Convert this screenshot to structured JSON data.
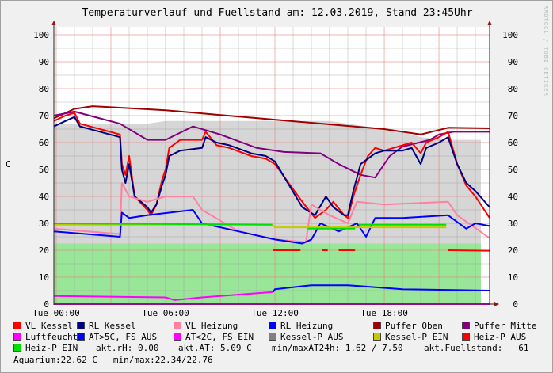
{
  "chart_data": {
    "type": "line",
    "title": "Temperaturverlauf und Fuellstand am: 12.03.2019, Stand 23:45Uhr",
    "ylabel": "C",
    "watermark": "RRDTOOL / TOBI OETIKER",
    "ylim": [
      0,
      100
    ],
    "xlim": [
      -0.13,
      23.78
    ],
    "yticks": [
      0,
      10,
      20,
      30,
      40,
      50,
      60,
      70,
      80,
      90,
      100
    ],
    "xticks": [
      {
        "h": 0,
        "label": "Tue 00:00"
      },
      {
        "h": 6,
        "label": "Tue 06:00"
      },
      {
        "h": 12,
        "label": "Tue 12:00"
      },
      {
        "h": 18,
        "label": "Tue 18:00"
      }
    ],
    "areas": [
      {
        "name": "Kessel-P AUS",
        "color": "#d6d6d6",
        "points": [
          [
            -0.13,
            67
          ],
          [
            2,
            67
          ],
          [
            5,
            67
          ],
          [
            6,
            68
          ],
          [
            10,
            68
          ],
          [
            15,
            68
          ],
          [
            16,
            67
          ],
          [
            18,
            65
          ],
          [
            19,
            64
          ],
          [
            20,
            62
          ],
          [
            21.5,
            61
          ],
          [
            23.3,
            61
          ],
          [
            23.3,
            0
          ]
        ]
      },
      {
        "name": "Fuellstand",
        "color": "#99e699",
        "points": [
          [
            -0.13,
            22.5
          ],
          [
            10,
            22.5
          ],
          [
            15,
            22.5
          ],
          [
            20,
            22.5
          ],
          [
            23.3,
            22.5
          ],
          [
            23.3,
            0
          ]
        ]
      }
    ],
    "series": [
      {
        "name": "Puffer Oben",
        "color": "#a00000",
        "points": [
          [
            -0.13,
            69
          ],
          [
            1,
            72.5
          ],
          [
            2,
            73.5
          ],
          [
            6,
            72
          ],
          [
            12,
            68.5
          ],
          [
            18,
            65
          ],
          [
            20,
            63
          ],
          [
            21.5,
            65.5
          ],
          [
            23.78,
            65.3
          ]
        ]
      },
      {
        "name": "Puffer Mitte",
        "color": "#800080",
        "points": [
          [
            -0.13,
            70
          ],
          [
            1,
            71.5
          ],
          [
            3.5,
            67
          ],
          [
            5,
            61
          ],
          [
            6,
            61
          ],
          [
            7.5,
            66
          ],
          [
            9,
            63
          ],
          [
            11,
            58
          ],
          [
            12.5,
            56.5
          ],
          [
            14.5,
            56
          ],
          [
            15.5,
            52
          ],
          [
            16.7,
            48
          ],
          [
            17.5,
            47
          ],
          [
            18.3,
            55
          ],
          [
            19,
            58.5
          ],
          [
            20.5,
            61
          ],
          [
            21,
            63
          ],
          [
            21.8,
            64
          ],
          [
            23.78,
            64
          ]
        ]
      },
      {
        "name": "VL Kessel",
        "color": "#ff0000",
        "points": [
          [
            -0.13,
            68
          ],
          [
            0.5,
            70
          ],
          [
            1,
            71
          ],
          [
            1.3,
            67
          ],
          [
            3.5,
            63
          ],
          [
            3.6,
            52
          ],
          [
            3.8,
            48
          ],
          [
            4,
            55
          ],
          [
            4.3,
            40
          ],
          [
            5,
            35
          ],
          [
            5.2,
            33
          ],
          [
            5.5,
            37
          ],
          [
            5.8,
            46
          ],
          [
            6,
            50
          ],
          [
            6.2,
            58
          ],
          [
            6.8,
            61
          ],
          [
            8,
            61
          ],
          [
            8.2,
            64
          ],
          [
            8.8,
            59
          ],
          [
            9.5,
            58
          ],
          [
            10.7,
            55
          ],
          [
            11.5,
            54
          ],
          [
            12,
            52
          ],
          [
            13.5,
            38
          ],
          [
            14.2,
            32
          ],
          [
            14.8,
            35
          ],
          [
            15.2,
            38
          ],
          [
            15.8,
            33
          ],
          [
            16,
            32
          ],
          [
            16.3,
            40
          ],
          [
            16.7,
            48
          ],
          [
            17.1,
            55
          ],
          [
            17.5,
            58
          ],
          [
            18,
            57
          ],
          [
            19,
            59
          ],
          [
            19.5,
            60
          ],
          [
            20,
            56
          ],
          [
            20.3,
            60
          ],
          [
            21,
            62
          ],
          [
            21.5,
            64
          ],
          [
            22,
            52
          ],
          [
            22.5,
            44
          ],
          [
            23,
            40
          ],
          [
            23.78,
            32
          ]
        ]
      },
      {
        "name": "RL Kessel",
        "color": "#000080",
        "points": [
          [
            -0.13,
            66
          ],
          [
            0.5,
            68
          ],
          [
            1,
            69.5
          ],
          [
            1.3,
            66
          ],
          [
            3.5,
            62
          ],
          [
            3.6,
            50
          ],
          [
            3.8,
            45
          ],
          [
            4,
            52
          ],
          [
            4.3,
            40
          ],
          [
            5,
            36
          ],
          [
            5.2,
            34
          ],
          [
            5.5,
            37
          ],
          [
            5.8,
            44
          ],
          [
            6,
            48
          ],
          [
            6.2,
            55
          ],
          [
            6.8,
            57
          ],
          [
            8,
            58
          ],
          [
            8.2,
            62
          ],
          [
            8.8,
            60
          ],
          [
            9.5,
            59
          ],
          [
            10.7,
            56
          ],
          [
            11.5,
            55
          ],
          [
            12,
            53
          ],
          [
            13.5,
            36
          ],
          [
            14.2,
            33
          ],
          [
            14.8,
            40
          ],
          [
            15.2,
            36
          ],
          [
            15.8,
            33
          ],
          [
            16,
            33
          ],
          [
            16.3,
            42
          ],
          [
            16.7,
            52
          ],
          [
            17.1,
            54
          ],
          [
            17.5,
            56
          ],
          [
            18,
            57
          ],
          [
            19,
            57
          ],
          [
            19.5,
            58
          ],
          [
            20,
            52
          ],
          [
            20.3,
            58
          ],
          [
            21,
            60
          ],
          [
            21.5,
            62
          ],
          [
            22,
            52
          ],
          [
            22.5,
            45
          ],
          [
            23,
            42
          ],
          [
            23.78,
            36
          ]
        ]
      },
      {
        "name": "VL Heizung",
        "color": "#ff80a0",
        "points": [
          [
            -0.13,
            28
          ],
          [
            3.5,
            26
          ],
          [
            3.6,
            45
          ],
          [
            4,
            40
          ],
          [
            5,
            38
          ],
          [
            6,
            40
          ],
          [
            7.5,
            40
          ],
          [
            8,
            35
          ],
          [
            10,
            27
          ],
          [
            12,
            24
          ],
          [
            13.7,
            23
          ],
          [
            14,
            37
          ],
          [
            15,
            33
          ],
          [
            16,
            30
          ],
          [
            16.5,
            38
          ],
          [
            18,
            37
          ],
          [
            21.5,
            38
          ],
          [
            22,
            33
          ],
          [
            23.78,
            24.5
          ]
        ]
      },
      {
        "name": "RL Heizung",
        "color": "#0000ff",
        "points": [
          [
            -0.13,
            27
          ],
          [
            3.5,
            25
          ],
          [
            3.6,
            34
          ],
          [
            4,
            32
          ],
          [
            5,
            33
          ],
          [
            7.5,
            35
          ],
          [
            8,
            30
          ],
          [
            10,
            27
          ],
          [
            12,
            24
          ],
          [
            13.5,
            22.5
          ],
          [
            14,
            24
          ],
          [
            14.5,
            30
          ],
          [
            15.5,
            27
          ],
          [
            16.5,
            30
          ],
          [
            17,
            25
          ],
          [
            17.5,
            32
          ],
          [
            19,
            32
          ],
          [
            21.5,
            33
          ],
          [
            22.5,
            28
          ],
          [
            23,
            30
          ],
          [
            23.78,
            29
          ]
        ]
      },
      {
        "name": "Kessel-P EIN",
        "color": "#c8c800",
        "points": [
          [
            -0.13,
            29.5
          ],
          [
            11.85,
            29.5
          ],
          [
            12,
            28.5
          ],
          [
            21.4,
            28.5
          ]
        ]
      },
      {
        "name": "Heiz-P EIN",
        "color": "#00e000",
        "points": [
          [
            -0.13,
            30
          ],
          [
            11.85,
            29.5
          ],
          null,
          [
            13.8,
            28
          ],
          [
            16.4,
            28
          ],
          null,
          [
            16.6,
            29.5
          ],
          [
            21.4,
            29.5
          ]
        ]
      },
      {
        "name": "Heiz-P AUS",
        "color": "#ff0000",
        "points": [
          [
            11.9,
            20
          ],
          [
            13.4,
            20
          ],
          null,
          [
            14.6,
            20
          ],
          [
            14.9,
            20
          ],
          null,
          [
            15.5,
            20
          ],
          [
            16.4,
            20
          ],
          null,
          [
            21.5,
            20
          ],
          [
            23.78,
            19.8
          ]
        ]
      },
      {
        "name": "AT<2C, FS EIN",
        "color": "#ff00ff",
        "points": [
          [
            -0.13,
            3
          ],
          [
            6,
            2.5
          ],
          [
            6.5,
            1.5
          ],
          [
            8,
            2.5
          ],
          [
            11.9,
            4.5
          ]
        ]
      },
      {
        "name": "AT>5C, FS AUS",
        "color": "#0000ff",
        "points": [
          [
            11.9,
            4.5
          ],
          [
            12,
            5.5
          ],
          [
            14,
            7
          ],
          [
            16,
            7
          ],
          [
            17,
            6.5
          ],
          [
            19,
            5.5
          ],
          [
            23.78,
            5
          ]
        ]
      },
      {
        "name": "Luftfeuchte",
        "color": "#ff00ff",
        "points": [
          [
            -0.13,
            0
          ],
          [
            23.78,
            0
          ]
        ]
      }
    ]
  },
  "legend": {
    "rows": [
      [
        {
          "label": "VL Kessel",
          "color": "#ff0000"
        },
        {
          "label": "RL Kessel",
          "color": "#000080"
        },
        {
          "label": "VL Heizung",
          "color": "#ff80a0"
        },
        {
          "label": "RL Heizung",
          "color": "#0000ff"
        },
        {
          "label": "Puffer Oben",
          "color": "#a00000"
        },
        {
          "label": "Puffer Mitte",
          "color": "#800080"
        }
      ],
      [
        {
          "label": "Luftfeuchte",
          "color": "#ff00ff"
        },
        {
          "label": "AT>5C, FS AUS",
          "color": "#0000ff"
        },
        {
          "label": "AT<2C, FS EIN",
          "color": "#ff00ff"
        },
        {
          "label": "Kessel-P AUS",
          "color": "#808080"
        },
        {
          "label": "Kessel-P EIN",
          "color": "#c8c800"
        },
        {
          "label": "Heiz-P AUS",
          "color": "#ff0000"
        }
      ]
    ],
    "heiz_p_ein": {
      "label": "Heiz-P EIN",
      "color": "#00e000"
    },
    "akt_rh": "akt.rH: 0.00",
    "akt_at": "akt.AT: 5.09 C",
    "minmax_at": "min/maxAT24h: 1.62 / 7.50",
    "fuellstand": "akt.Fuellstand:   61",
    "aquarium": "Aquarium:22.62 C   min/max:22.34/22.76"
  }
}
